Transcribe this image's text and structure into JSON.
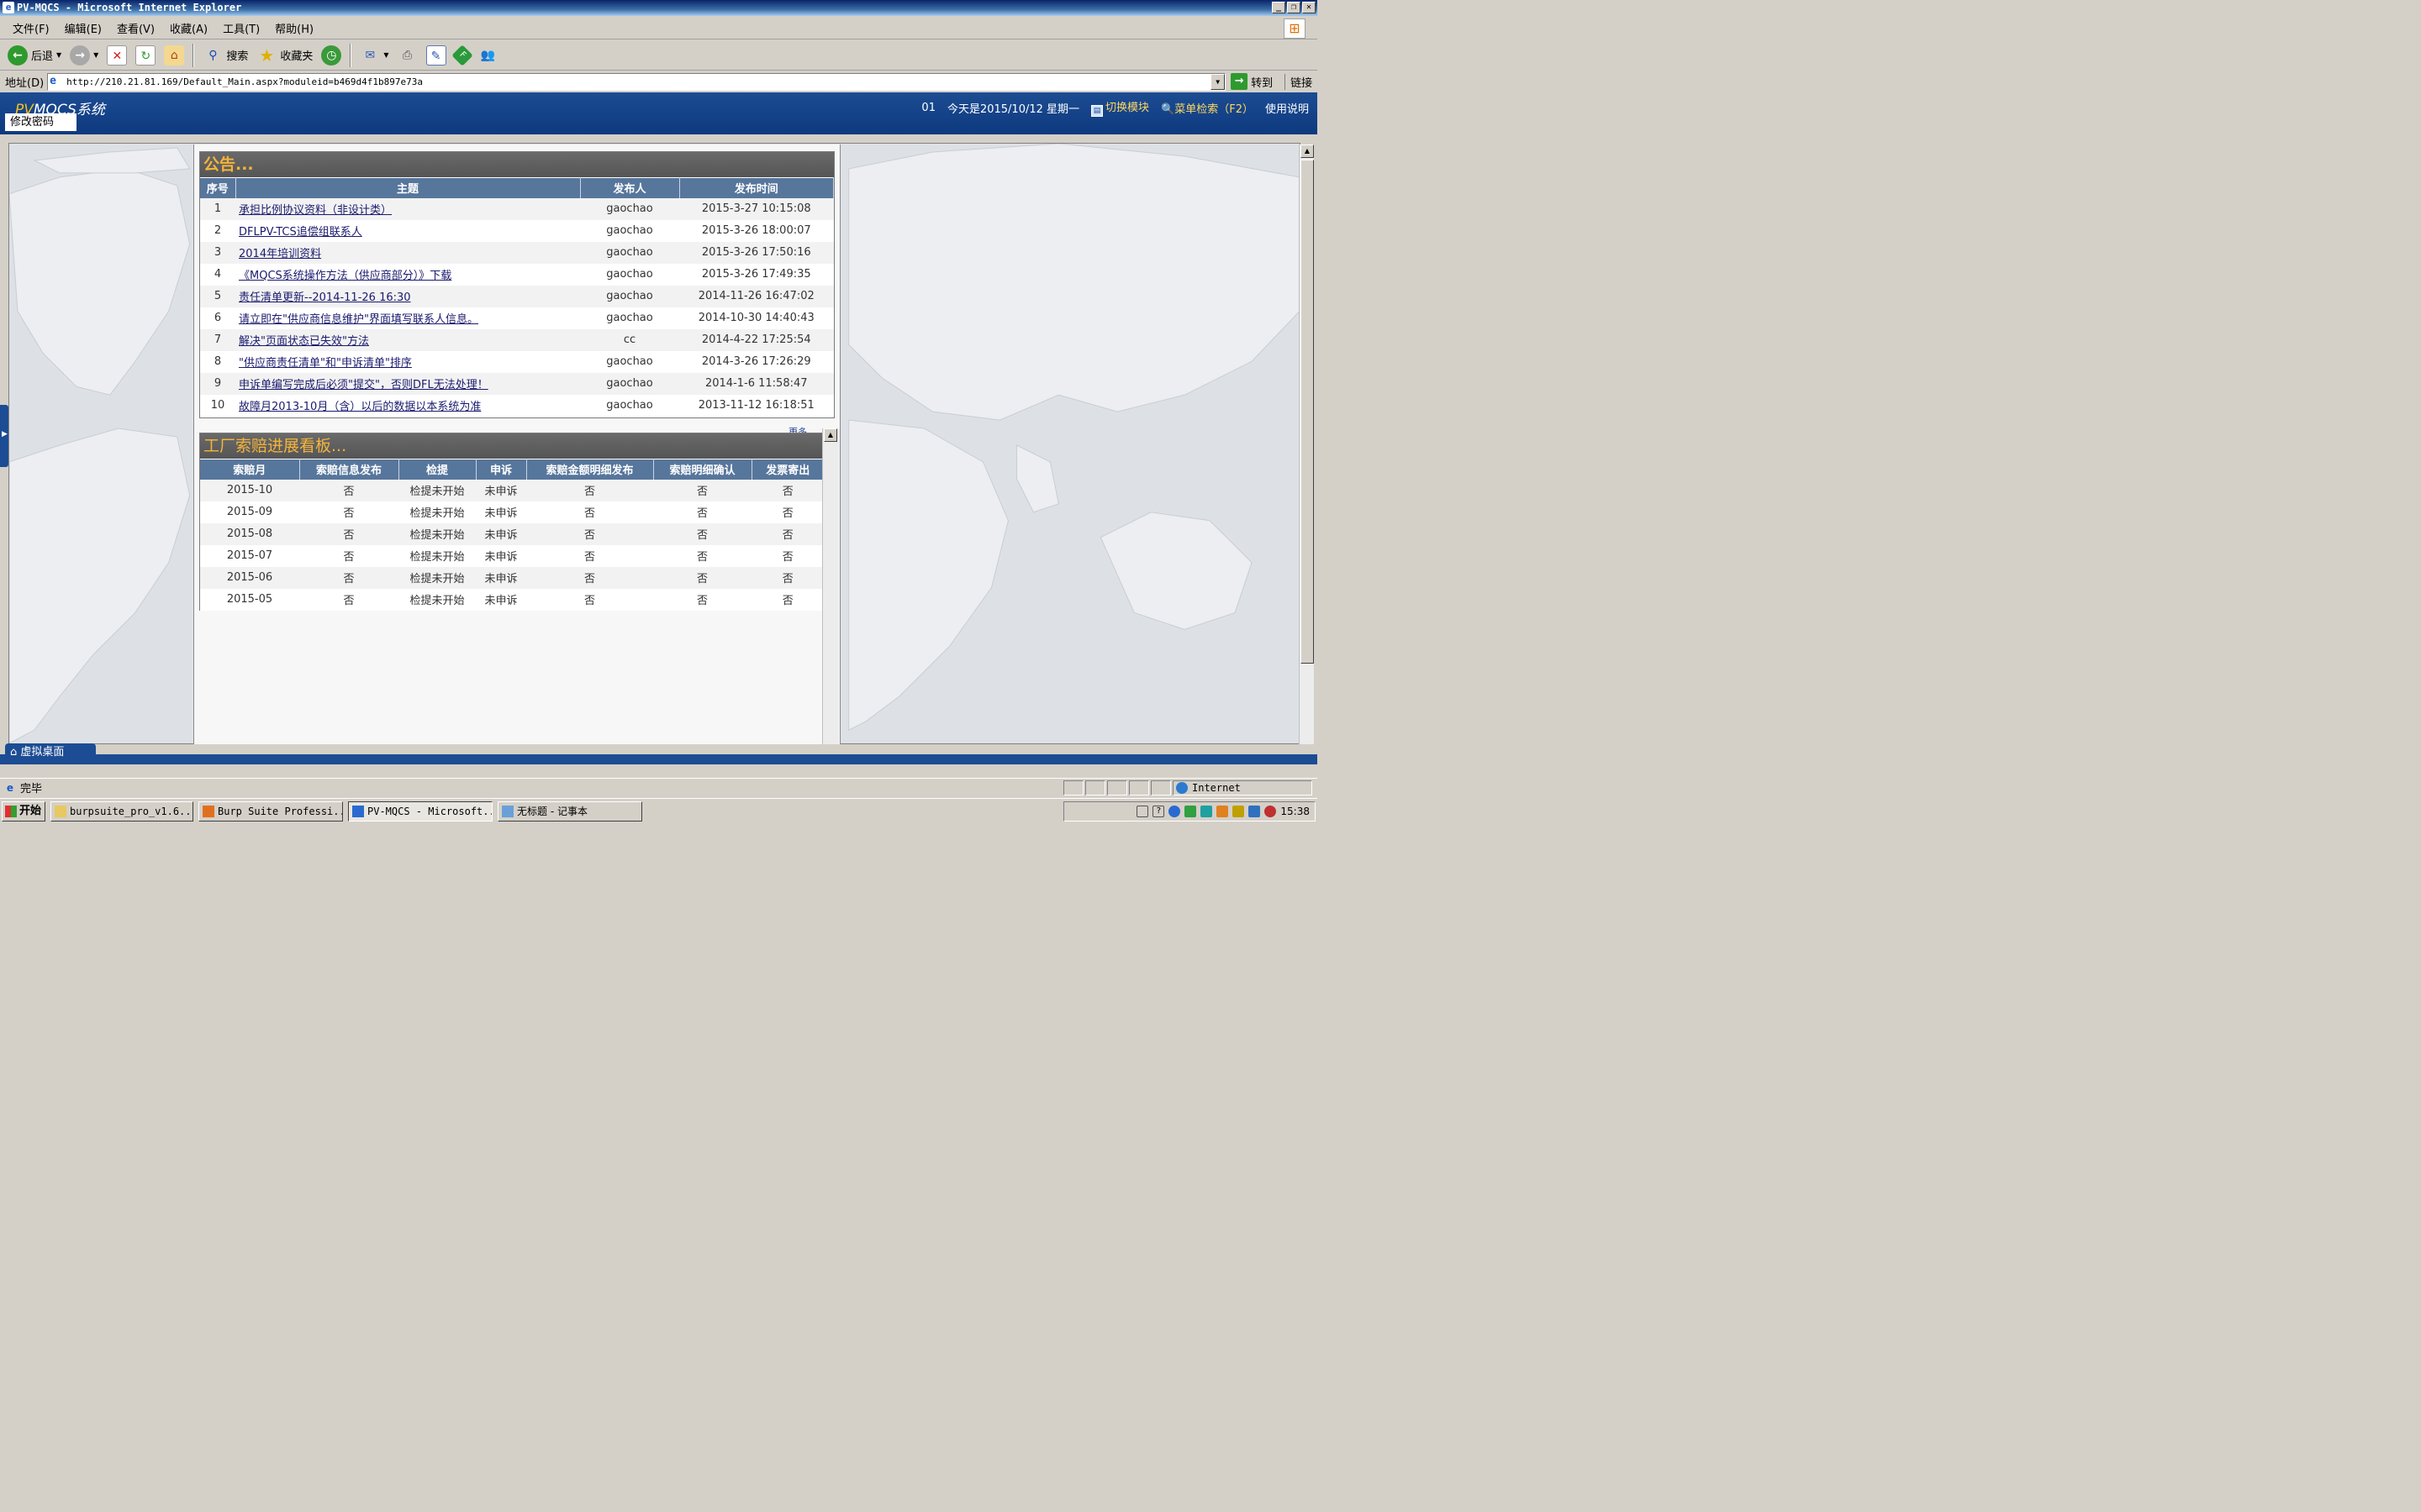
{
  "window": {
    "title": "PV-MQCS - Microsoft Internet Explorer"
  },
  "menu": [
    "文件(F)",
    "编辑(E)",
    "查看(V)",
    "收藏(A)",
    "工具(T)",
    "帮助(H)"
  ],
  "toolbar": {
    "back": "后退",
    "search": "搜索",
    "favorites": "收藏夹"
  },
  "address": {
    "label": "地址(D)",
    "url": "http://210.21.81.169/Default_Main.aspx?moduleid=b469d4f1b897e73a",
    "go": "转到",
    "links": "链接"
  },
  "app": {
    "logo_pv": "PV",
    "logo_rest": "MQCS系统",
    "user": "01",
    "today": "今天是2015/10/12 星期一",
    "switch_module": "切换模块",
    "menu_search": "菜单检索（F2）",
    "help": "使用说明",
    "change_password": "修改密码"
  },
  "notices": {
    "title": "公告...",
    "columns": [
      "序号",
      "主题",
      "发布人",
      "发布时间"
    ],
    "rows": [
      {
        "no": "1",
        "subject": "承担比例协议资料（非设计类）",
        "publisher": "gaochao",
        "time": "2015-3-27 10:15:08"
      },
      {
        "no": "2",
        "subject": "DFLPV-TCS追偿组联系人",
        "publisher": "gaochao",
        "time": "2015-3-26 18:00:07"
      },
      {
        "no": "3",
        "subject": "2014年培训资料",
        "publisher": "gaochao",
        "time": "2015-3-26 17:50:16"
      },
      {
        "no": "4",
        "subject": "《MQCS系统操作方法（供应商部分）》下载",
        "publisher": "gaochao",
        "time": "2015-3-26 17:49:35"
      },
      {
        "no": "5",
        "subject": "责任清单更新--2014-11-26 16:30",
        "publisher": "gaochao",
        "time": "2014-11-26 16:47:02"
      },
      {
        "no": "6",
        "subject": "请立即在\"供应商信息维护\"界面填写联系人信息。",
        "publisher": "gaochao",
        "time": "2014-10-30 14:40:43"
      },
      {
        "no": "7",
        "subject": "解决\"页面状态已失效\"方法",
        "publisher": "cc",
        "time": "2014-4-22 17:25:54"
      },
      {
        "no": "8",
        "subject": "\"供应商责任清单\"和\"申诉清单\"排序",
        "publisher": "gaochao",
        "time": "2014-3-26 17:26:29"
      },
      {
        "no": "9",
        "subject": "申诉单编写完成后必须\"提交\"，否则DFL无法处理！",
        "publisher": "gaochao",
        "time": "2014-1-6 11:58:47"
      },
      {
        "no": "10",
        "subject": "故障月2013-10月（含）以后的数据以本系统为准",
        "publisher": "gaochao",
        "time": "2013-11-12 16:18:51"
      }
    ],
    "more": "更多..."
  },
  "claims": {
    "title": "工厂索赔进展看板...",
    "columns": [
      "索赔月",
      "索赔信息发布",
      "检提",
      "申诉",
      "索赔金额明细发布",
      "索赔明细确认",
      "发票寄出"
    ],
    "rows": [
      [
        "2015-10",
        "否",
        "检提未开始",
        "未申诉",
        "否",
        "否",
        "否"
      ],
      [
        "2015-09",
        "否",
        "检提未开始",
        "未申诉",
        "否",
        "否",
        "否"
      ],
      [
        "2015-08",
        "否",
        "检提未开始",
        "未申诉",
        "否",
        "否",
        "否"
      ],
      [
        "2015-07",
        "否",
        "检提未开始",
        "未申诉",
        "否",
        "否",
        "否"
      ],
      [
        "2015-06",
        "否",
        "检提未开始",
        "未申诉",
        "否",
        "否",
        "否"
      ],
      [
        "2015-05",
        "否",
        "检提未开始",
        "未申诉",
        "否",
        "否",
        "否"
      ]
    ]
  },
  "virtual_desktop": "虚拟桌面",
  "status": {
    "text": "完毕",
    "zone": "Internet"
  },
  "taskbar": {
    "start": "开始",
    "tasks": [
      "burpsuite_pro_v1.6....",
      "Burp Suite Professi...",
      "PV-MQCS - Microsoft...",
      "无标题 - 记事本"
    ],
    "clock": "15:38"
  },
  "colors": {
    "header_blue": "#1c4c93",
    "table_header": "#57769c",
    "panel_title": "#f5b43a"
  }
}
